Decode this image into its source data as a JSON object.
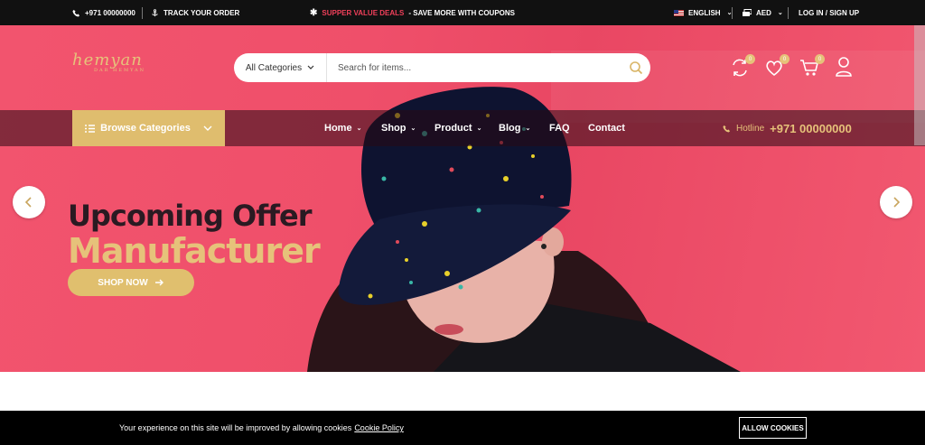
{
  "topbar": {
    "phone": "+971 00000000",
    "track_order": "TRACK YOUR ORDER",
    "promo_accent": "SUPPER VALUE DEALS",
    "promo_rest": "- SAVE MORE WITH COUPONS",
    "language": "ENGLISH",
    "currency": "AED",
    "login": "LOG IN / SIGN UP"
  },
  "logo": {
    "text": "hemyan",
    "sub": "DAR HEMYAN"
  },
  "search": {
    "category": "All Categories",
    "placeholder": "Search for items..."
  },
  "badges": {
    "compare": "0",
    "wishlist": "0",
    "cart": "0"
  },
  "nav": {
    "browse": "Browse Categories",
    "items": [
      {
        "label": "Home",
        "dropdown": true
      },
      {
        "label": "Shop",
        "dropdown": true
      },
      {
        "label": "Product",
        "dropdown": true
      },
      {
        "label": "Blog",
        "dropdown": true
      },
      {
        "label": "FAQ",
        "dropdown": false
      },
      {
        "label": "Contact",
        "dropdown": false
      }
    ],
    "hotline_label": "Hotline",
    "hotline_number": "+971 00000000"
  },
  "hero": {
    "line1": "Upcoming Offer",
    "line2": "Manufacturer",
    "cta": "SHOP NOW"
  },
  "cookie": {
    "message": "Your experience on this site will be improved by allowing cookies",
    "policy": "Cookie Policy",
    "allow": "ALLOW COOKIES"
  },
  "colors": {
    "accent": "#e6c27a",
    "hero_bg": "#ef4f6a",
    "dark": "#111111"
  }
}
